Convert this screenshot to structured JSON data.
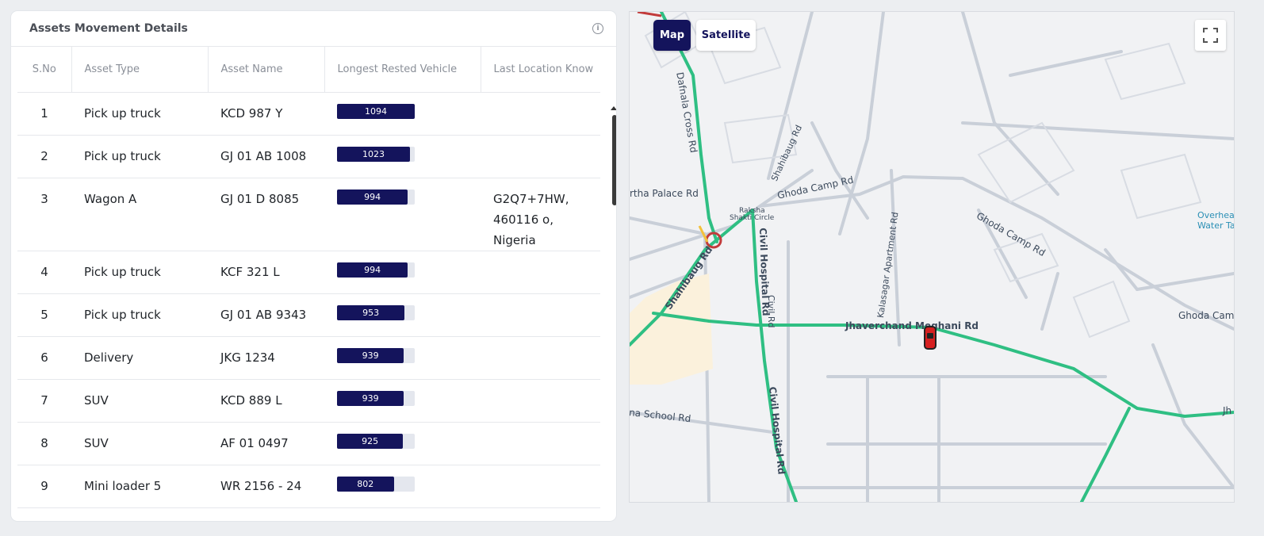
{
  "panel": {
    "title": "Assets Movement Details"
  },
  "table": {
    "headers": [
      "S.No",
      "Asset Type",
      "Asset Name",
      "Longest Rested Vehicle",
      "Last Location Know"
    ],
    "rows": [
      {
        "sno": "1",
        "type": "Pick up truck",
        "name": "KCD 987 Y",
        "rested": "1094",
        "rested_fraction": 1.0,
        "location": ""
      },
      {
        "sno": "2",
        "type": "Pick up truck",
        "name": "GJ 01 AB 1008",
        "rested": "1023",
        "rested_fraction": 0.94,
        "location": ""
      },
      {
        "sno": "3",
        "type": "Wagon A",
        "name": "GJ 01 D 8085",
        "rested": "994",
        "rested_fraction": 0.91,
        "location": "G2Q7+7HW, 460116 o, Nigeria"
      },
      {
        "sno": "4",
        "type": "Pick up truck",
        "name": "KCF 321 L",
        "rested": "994",
        "rested_fraction": 0.91,
        "location": ""
      },
      {
        "sno": "5",
        "type": "Pick up truck",
        "name": "GJ 01 AB 9343",
        "rested": "953",
        "rested_fraction": 0.87,
        "location": ""
      },
      {
        "sno": "6",
        "type": "Delivery",
        "name": "JKG 1234",
        "rested": "939",
        "rested_fraction": 0.86,
        "location": ""
      },
      {
        "sno": "7",
        "type": "SUV",
        "name": "KCD 889 L",
        "rested": "939",
        "rested_fraction": 0.86,
        "location": ""
      },
      {
        "sno": "8",
        "type": "SUV",
        "name": "AF 01 0497",
        "rested": "925",
        "rested_fraction": 0.85,
        "location": ""
      },
      {
        "sno": "9",
        "type": "Mini loader 5",
        "name": "WR 2156 - 24",
        "rested": "802",
        "rested_fraction": 0.73,
        "location": ""
      }
    ]
  },
  "map": {
    "map_button": "Map",
    "satellite_button": "Satellite",
    "fullscreen_icon": "fullscreen-icon",
    "labels": {
      "cross_rd": "Dafnala Cross Rd",
      "palace_rd": "rtha Palace Rd",
      "shahibaug_rd_top": "Shahibaug Rd",
      "ghoda_camp_rd_1": "Ghoda Camp Rd",
      "raksha": "Raksha",
      "shakti_circle": "Shakti Circle",
      "ghoda_camp_rd_2": "Ghoda Camp Rd",
      "overhead": "Overhea",
      "water_ta": "Water Ta",
      "kalasagar": "Kalasagar Apartment Rd",
      "civil_rd": "Civil Rd",
      "civil_hospital_rd_1": "Civil Hospital Rd",
      "shahibaug_rd": "Shahibaug Rd",
      "jhaverchand": "Jhaverchand Meghani Rd",
      "ghoda_camp_right": "Ghoda Camp",
      "civil_hospital_rd_2": "Civil Hospital Rd",
      "school_rd": "na School Rd",
      "jh_edge": "Jh"
    },
    "colors": {
      "road": "#c9cfd8",
      "traffic": "#2fbf83",
      "brand": "#14145c"
    }
  }
}
